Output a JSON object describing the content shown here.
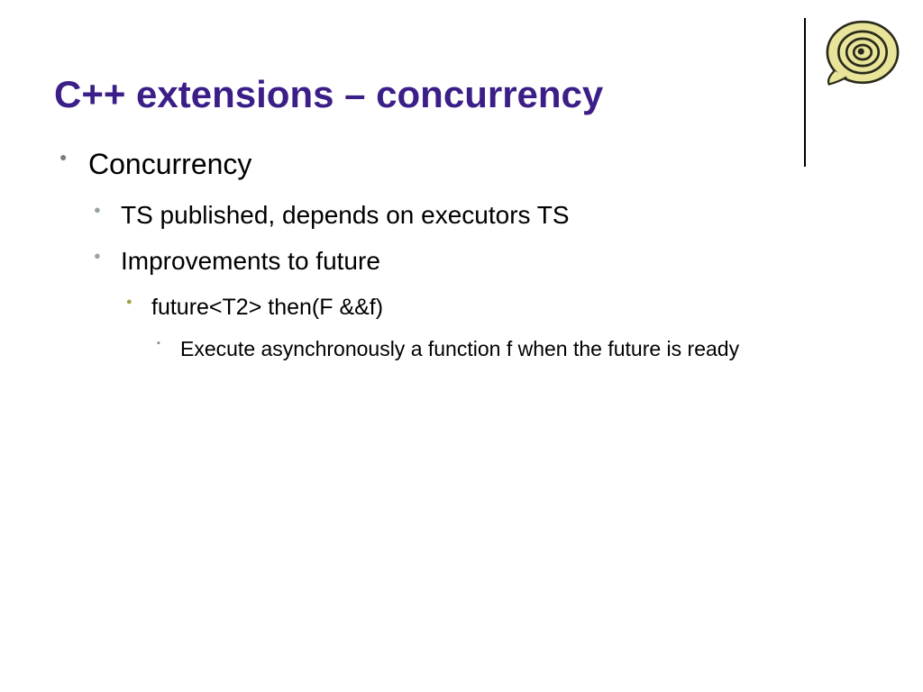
{
  "title": "C++ extensions – concurrency",
  "bullets": {
    "lvl1_0": "Concurrency",
    "lvl2_0": "TS published, depends on executors TS",
    "lvl2_1": "Improvements to future",
    "lvl3_0": "future<T2> then(F &&f)",
    "lvl4_0": "Execute asynchronously a function f when the future is ready"
  },
  "colors": {
    "title": "#3b1e87",
    "bullet_lvl1": "#7b7b7b",
    "bullet_lvl2": "#96a69a",
    "bullet_lvl3": "#a0a040",
    "bullet_lvl4": "#888888"
  }
}
